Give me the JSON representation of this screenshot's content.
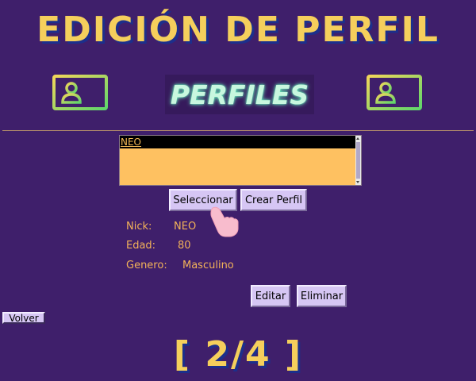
{
  "header": {
    "title": "EDICIÓN DE PERFIL",
    "subtitle": "PERFILES",
    "left_icon": "id-card-icon",
    "right_icon": "id-card-icon"
  },
  "profile_list": {
    "items": [
      "NEO"
    ],
    "selected_index": 0
  },
  "actions": {
    "select_label": "Seleccionar",
    "create_label": "Crear Perfil",
    "edit_label": "Editar",
    "delete_label": "Eliminar",
    "back_label": "Volver"
  },
  "profile_info": {
    "nick_label": "Nick:",
    "nick_value": "NEO",
    "age_label": "Edad:",
    "age_value": "80",
    "gender_label": "Genero:",
    "gender_value": "Masculino"
  },
  "pagination": {
    "indicator": "[ 2/4 ]"
  },
  "colors": {
    "background": "#3f1f6b",
    "title": "#f5cf5c",
    "title_shadow": "#1c2f8c",
    "list_bg": "#fec161",
    "info_text": "#f3b259",
    "button_bg": "#d6c6f4",
    "neon": "#c8f7df"
  },
  "cursor_icon": "hand-pointer-icon"
}
